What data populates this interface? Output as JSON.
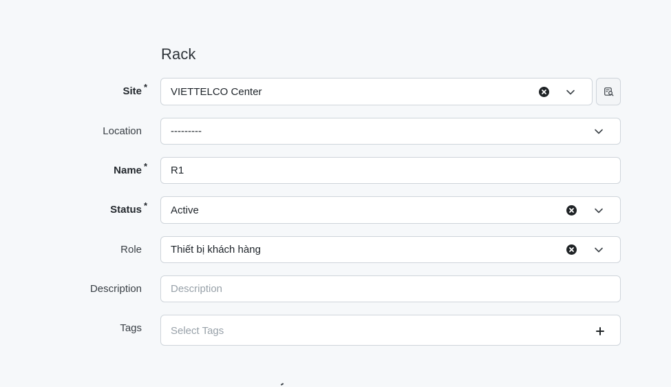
{
  "section": {
    "title": "Rack"
  },
  "fields": {
    "site": {
      "label": "Site",
      "required_mark": "*",
      "value": "VIETTELCO Center"
    },
    "location": {
      "label": "Location",
      "value": "---------"
    },
    "name": {
      "label": "Name",
      "required_mark": "*",
      "value": "R1"
    },
    "status": {
      "label": "Status",
      "required_mark": "*",
      "value": "Active"
    },
    "role": {
      "label": "Role",
      "value": "Thiết bị khách hàng"
    },
    "description": {
      "label": "Description",
      "value": "",
      "placeholder": "Description"
    },
    "tags": {
      "label": "Tags",
      "placeholder": "Select Tags"
    }
  },
  "icons": {
    "clear": "clear-circle-x-icon",
    "dropdown": "chevron-down-icon",
    "selector": "search-list-icon",
    "add": "plus-icon"
  },
  "colors": {
    "background": "#f6f8fa",
    "field_border": "#ced4da",
    "field_background": "#ffffff",
    "placeholder_text": "#98a1a9"
  }
}
